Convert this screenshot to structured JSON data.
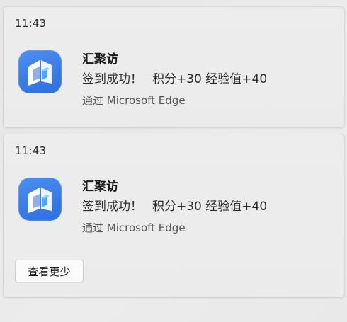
{
  "notifications": [
    {
      "time": "11:43",
      "app_name": "汇聚访",
      "message_part1": "签到成功！",
      "message_part2": "积分+30 经验值+40",
      "source": "通过 Microsoft Edge",
      "icon": "huijufang-app-icon"
    },
    {
      "time": "11:43",
      "app_name": "汇聚访",
      "message_part1": "签到成功！",
      "message_part2": "积分+30 经验值+40",
      "source": "通过 Microsoft Edge",
      "icon": "huijufang-app-icon",
      "see_less_label": "查看更少"
    }
  ],
  "colors": {
    "icon_blue": "#3a80e8",
    "card_background": "#ececec"
  }
}
